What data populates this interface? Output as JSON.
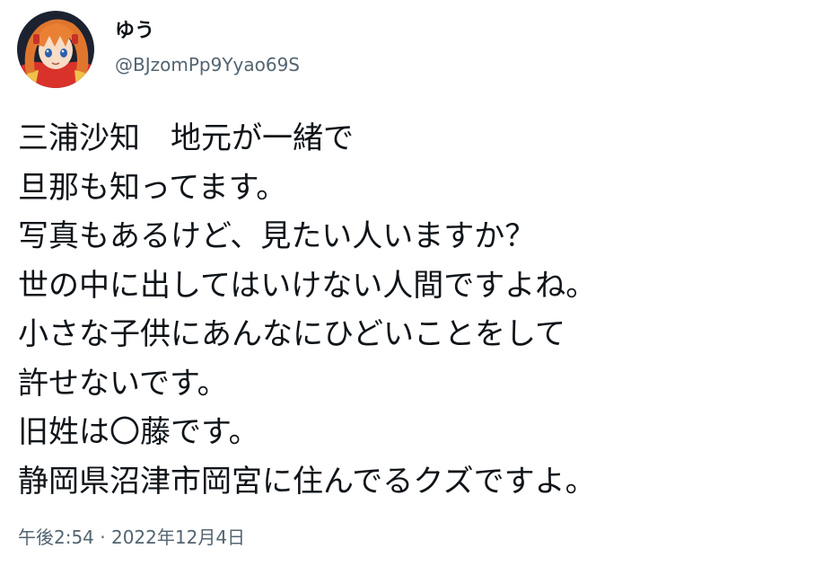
{
  "author": {
    "display_name": "ゆう",
    "handle": "@BJzomPp9Yyao69S",
    "avatar_icon": "anime-girl-avatar"
  },
  "tweet": {
    "lines": [
      "三浦沙知　地元が一緒で",
      "旦那も知ってます。",
      "写真もあるけど、見たい人いますか？",
      "世の中に出してはいけない人間ですよね。",
      "小さな子供にあんなにひどいことをして",
      "許せないです。",
      "旧姓は〇藤です。",
      "静岡県沼津市岡宮に住んでるクズですよ。"
    ],
    "timestamp": "午後2:54 · 2022年12月4日"
  },
  "colors": {
    "text": "#0f1419",
    "secondary": "#536471",
    "background": "#ffffff"
  }
}
